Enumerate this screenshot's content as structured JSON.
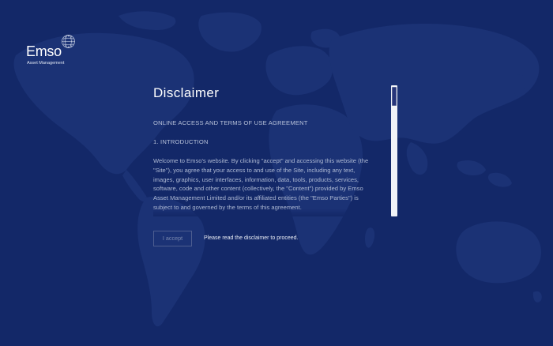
{
  "brand": {
    "name": "Emso",
    "tagline": "Asset Management",
    "logo_mark_icon": "globe-dots-icon"
  },
  "colors": {
    "background": "#132868",
    "map": "#1b3275",
    "text": "#c9d2e6"
  },
  "page": {
    "title": "Disclaimer"
  },
  "disclaimer": {
    "subtitle": "ONLINE ACCESS AND TERMS OF USE AGREEMENT",
    "section_heading": "1. INTRODUCTION",
    "body": "Welcome to Emso's website. By clicking \"accept\" and accessing this website (the \"Site\"), you agree that your access to and use of the Site, including any text, images, graphics, user interfaces, information, data, tools, products, services, software, code and other content (collectively, the \"Content\") provided by Emso Asset Management Limited and/or its affiliated entities (the \"Emso Parties\") is subject to and governed by the terms of this agreement."
  },
  "actions": {
    "accept_label": "I accept",
    "notice": "Please read the disclaimer to proceed."
  }
}
